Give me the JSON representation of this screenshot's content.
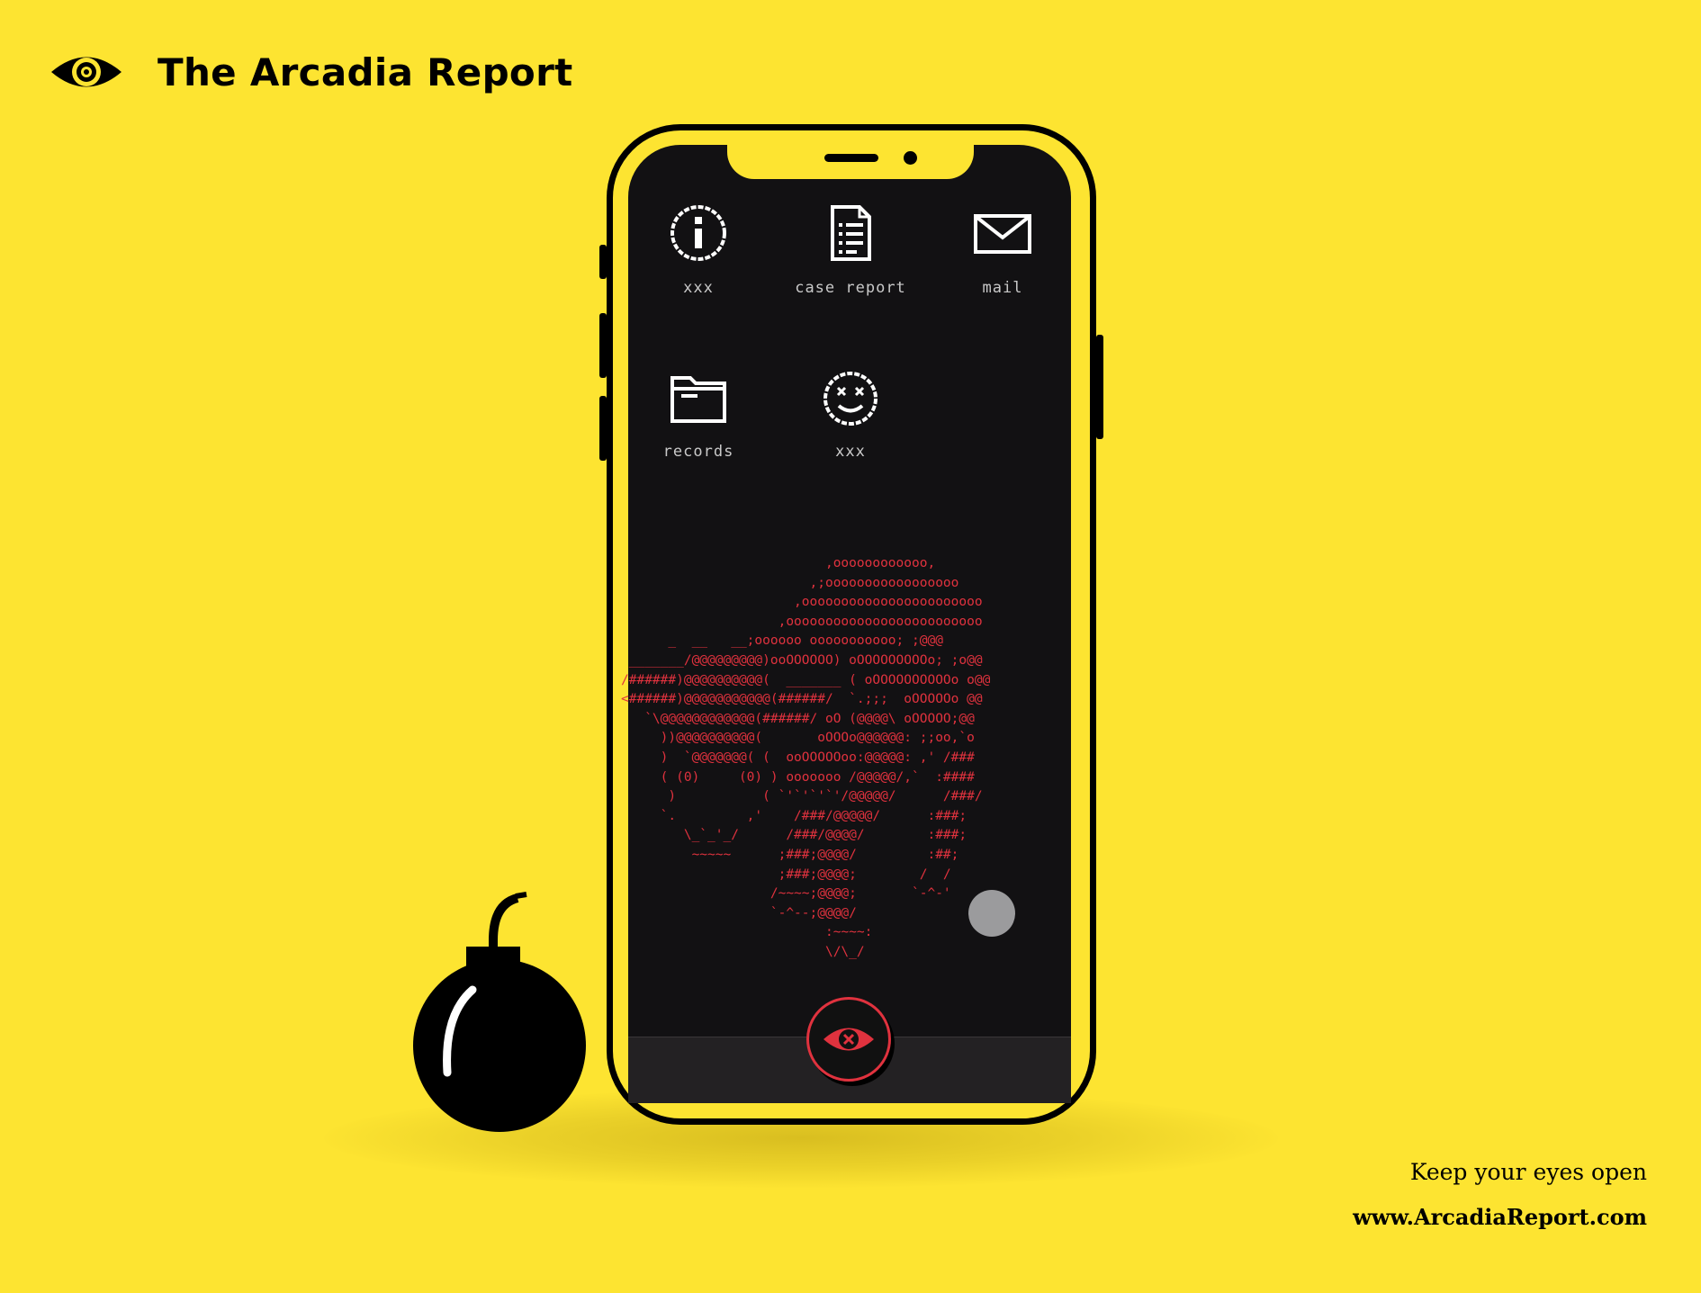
{
  "brand": {
    "title": "The Arcadia Report"
  },
  "apps": [
    {
      "label": "xxx"
    },
    {
      "label": "case report"
    },
    {
      "label": "mail"
    },
    {
      "label": "records"
    },
    {
      "label": "xxx"
    }
  ],
  "ascii_art": "                          ,oooooooooooo,\n                        ,;ooooooooooooooooo\n                      ,ooooooooooooooooooooooo\n                    ,ooooooooooooooooooooooooo\n      _  __   __;oooooo ooooooooooo; ;@@@\n _______/@@@@@@@@@)ooOOOOOO) oOOOOOOOOOo; ;o@@\n/######)@@@@@@@@@@(  _______ ( oOOOOOOOOOOo o@@\n<######)@@@@@@@@@@@(######/  `.;;;  oOOOOOo @@\n   `\\@@@@@@@@@@@@(######/ oO (@@@@\\ oOOOOO;@@\n     ))@@@@@@@@@@(       oOOOo@@@@@@: ;;oo,`o\n     )  `@@@@@@@( (  ooOOOOOoo:@@@@@: ,' /###\n     ( (0)     (0) ) ooooooo /@@@@@/,`  :####\n      )           ( `'`'`'`'/@@@@@/      /###/\n     `.         ,'    /###/@@@@@/      :###;\n        \\_`_'_/      /###/@@@@/        :###;\n         ~~~~~      ;###;@@@@/         :##;\n                    ;###;@@@@;        /  /\n                   /~~~~;@@@@;       `-^-'\n                   `-^--;@@@@/\n                          :~~~~:\n                          \\/\\_/",
  "footer": {
    "tagline": "Keep your eyes open",
    "website": "www.ArcadiaReport.com"
  },
  "colors": {
    "background": "#fde431",
    "screen": "#121113",
    "accent": "#e0323e",
    "icon": "#ffffff"
  },
  "icons": [
    "eye-logo-icon",
    "info-icon",
    "document-icon",
    "mail-icon",
    "folder-icon",
    "dizzy-face-icon",
    "eye-x-icon",
    "bomb-icon"
  ]
}
